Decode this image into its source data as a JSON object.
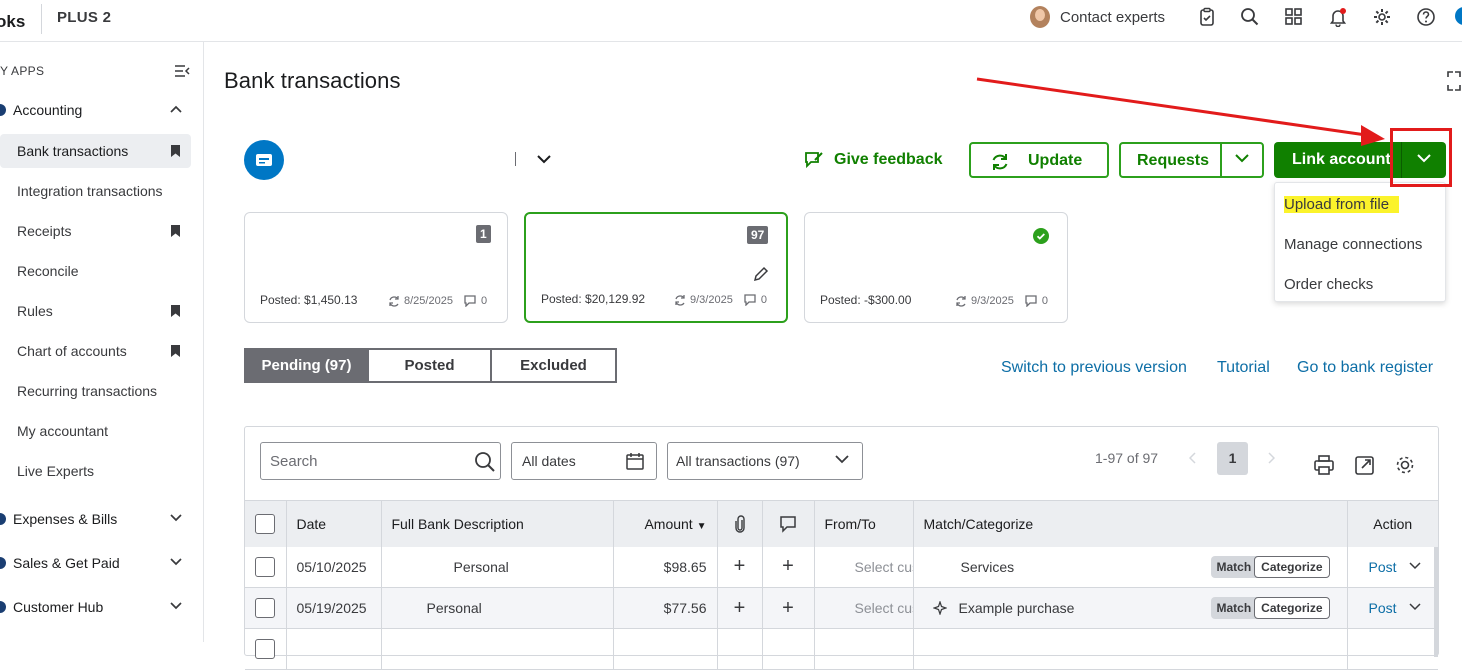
{
  "topbar": {
    "brand": "oks",
    "plan": "PLUS 2",
    "contact": "Contact experts",
    "icons": [
      "checklist-icon",
      "search-icon",
      "apps-icon",
      "bell-icon",
      "gear-icon",
      "help-icon"
    ]
  },
  "sidebar": {
    "my_apps": "Y APPS",
    "accounting": "Accounting",
    "items": [
      {
        "label": "Bank transactions",
        "bookmarked": true,
        "active": true
      },
      {
        "label": "Integration transactions",
        "bookmarked": false
      },
      {
        "label": "Receipts",
        "bookmarked": true
      },
      {
        "label": "Reconcile",
        "bookmarked": false
      },
      {
        "label": "Rules",
        "bookmarked": true
      },
      {
        "label": "Chart of accounts",
        "bookmarked": true
      },
      {
        "label": "Recurring transactions",
        "bookmarked": false
      },
      {
        "label": "My accountant",
        "bookmarked": false
      },
      {
        "label": "Live Experts",
        "bookmarked": false
      }
    ],
    "sections": [
      "Expenses & Bills",
      "Sales & Get Paid",
      "Customer Hub"
    ]
  },
  "page": {
    "title": "Bank transactions",
    "give_feedback": "Give feedback",
    "update": "Update",
    "requests": "Requests",
    "link_account": "Link account",
    "dropdown": [
      "Upload from file",
      "Manage connections",
      "Order checks"
    ]
  },
  "cards": [
    {
      "badge": "1",
      "posted": "Posted: $1,450.13",
      "date": "8/25/2025",
      "comments": "0"
    },
    {
      "badge": "97",
      "posted": "Posted: $20,129.92",
      "date": "9/3/2025",
      "comments": "0"
    },
    {
      "badge": "",
      "posted": "Posted: -$300.00",
      "date": "9/3/2025",
      "comments": "0"
    }
  ],
  "tabs": [
    "Pending (97)",
    "Posted",
    "Excluded"
  ],
  "links": {
    "previous": "Switch to previous version",
    "tutorial": "Tutorial",
    "register": "Go to bank register"
  },
  "filters": {
    "search_placeholder": "Search",
    "dates": "All dates",
    "transactions": "All transactions (97)",
    "pager": "1-97 of 97",
    "page": "1"
  },
  "table": {
    "headers": [
      "Date",
      "Full Bank Description",
      "Amount",
      "From/To",
      "Match/Categorize",
      "Action"
    ],
    "rows": [
      {
        "date": "05/10/2025",
        "desc": "Personal",
        "amount": "$98.65",
        "from": "Select cus",
        "category": "Services",
        "match": "Match",
        "categorize": "Categorize",
        "action": "Post"
      },
      {
        "date": "05/19/2025",
        "desc": "Personal",
        "amount": "$77.56",
        "from": "Select cus",
        "category": "Example purchase",
        "match": "Match",
        "categorize": "Categorize",
        "action": "Post"
      }
    ]
  },
  "colors": {
    "green": "#2ca01c",
    "dark_green": "#108000",
    "link": "#0d6ea6",
    "red_annotation": "#e21b1b",
    "highlight": "#fbf32b"
  }
}
